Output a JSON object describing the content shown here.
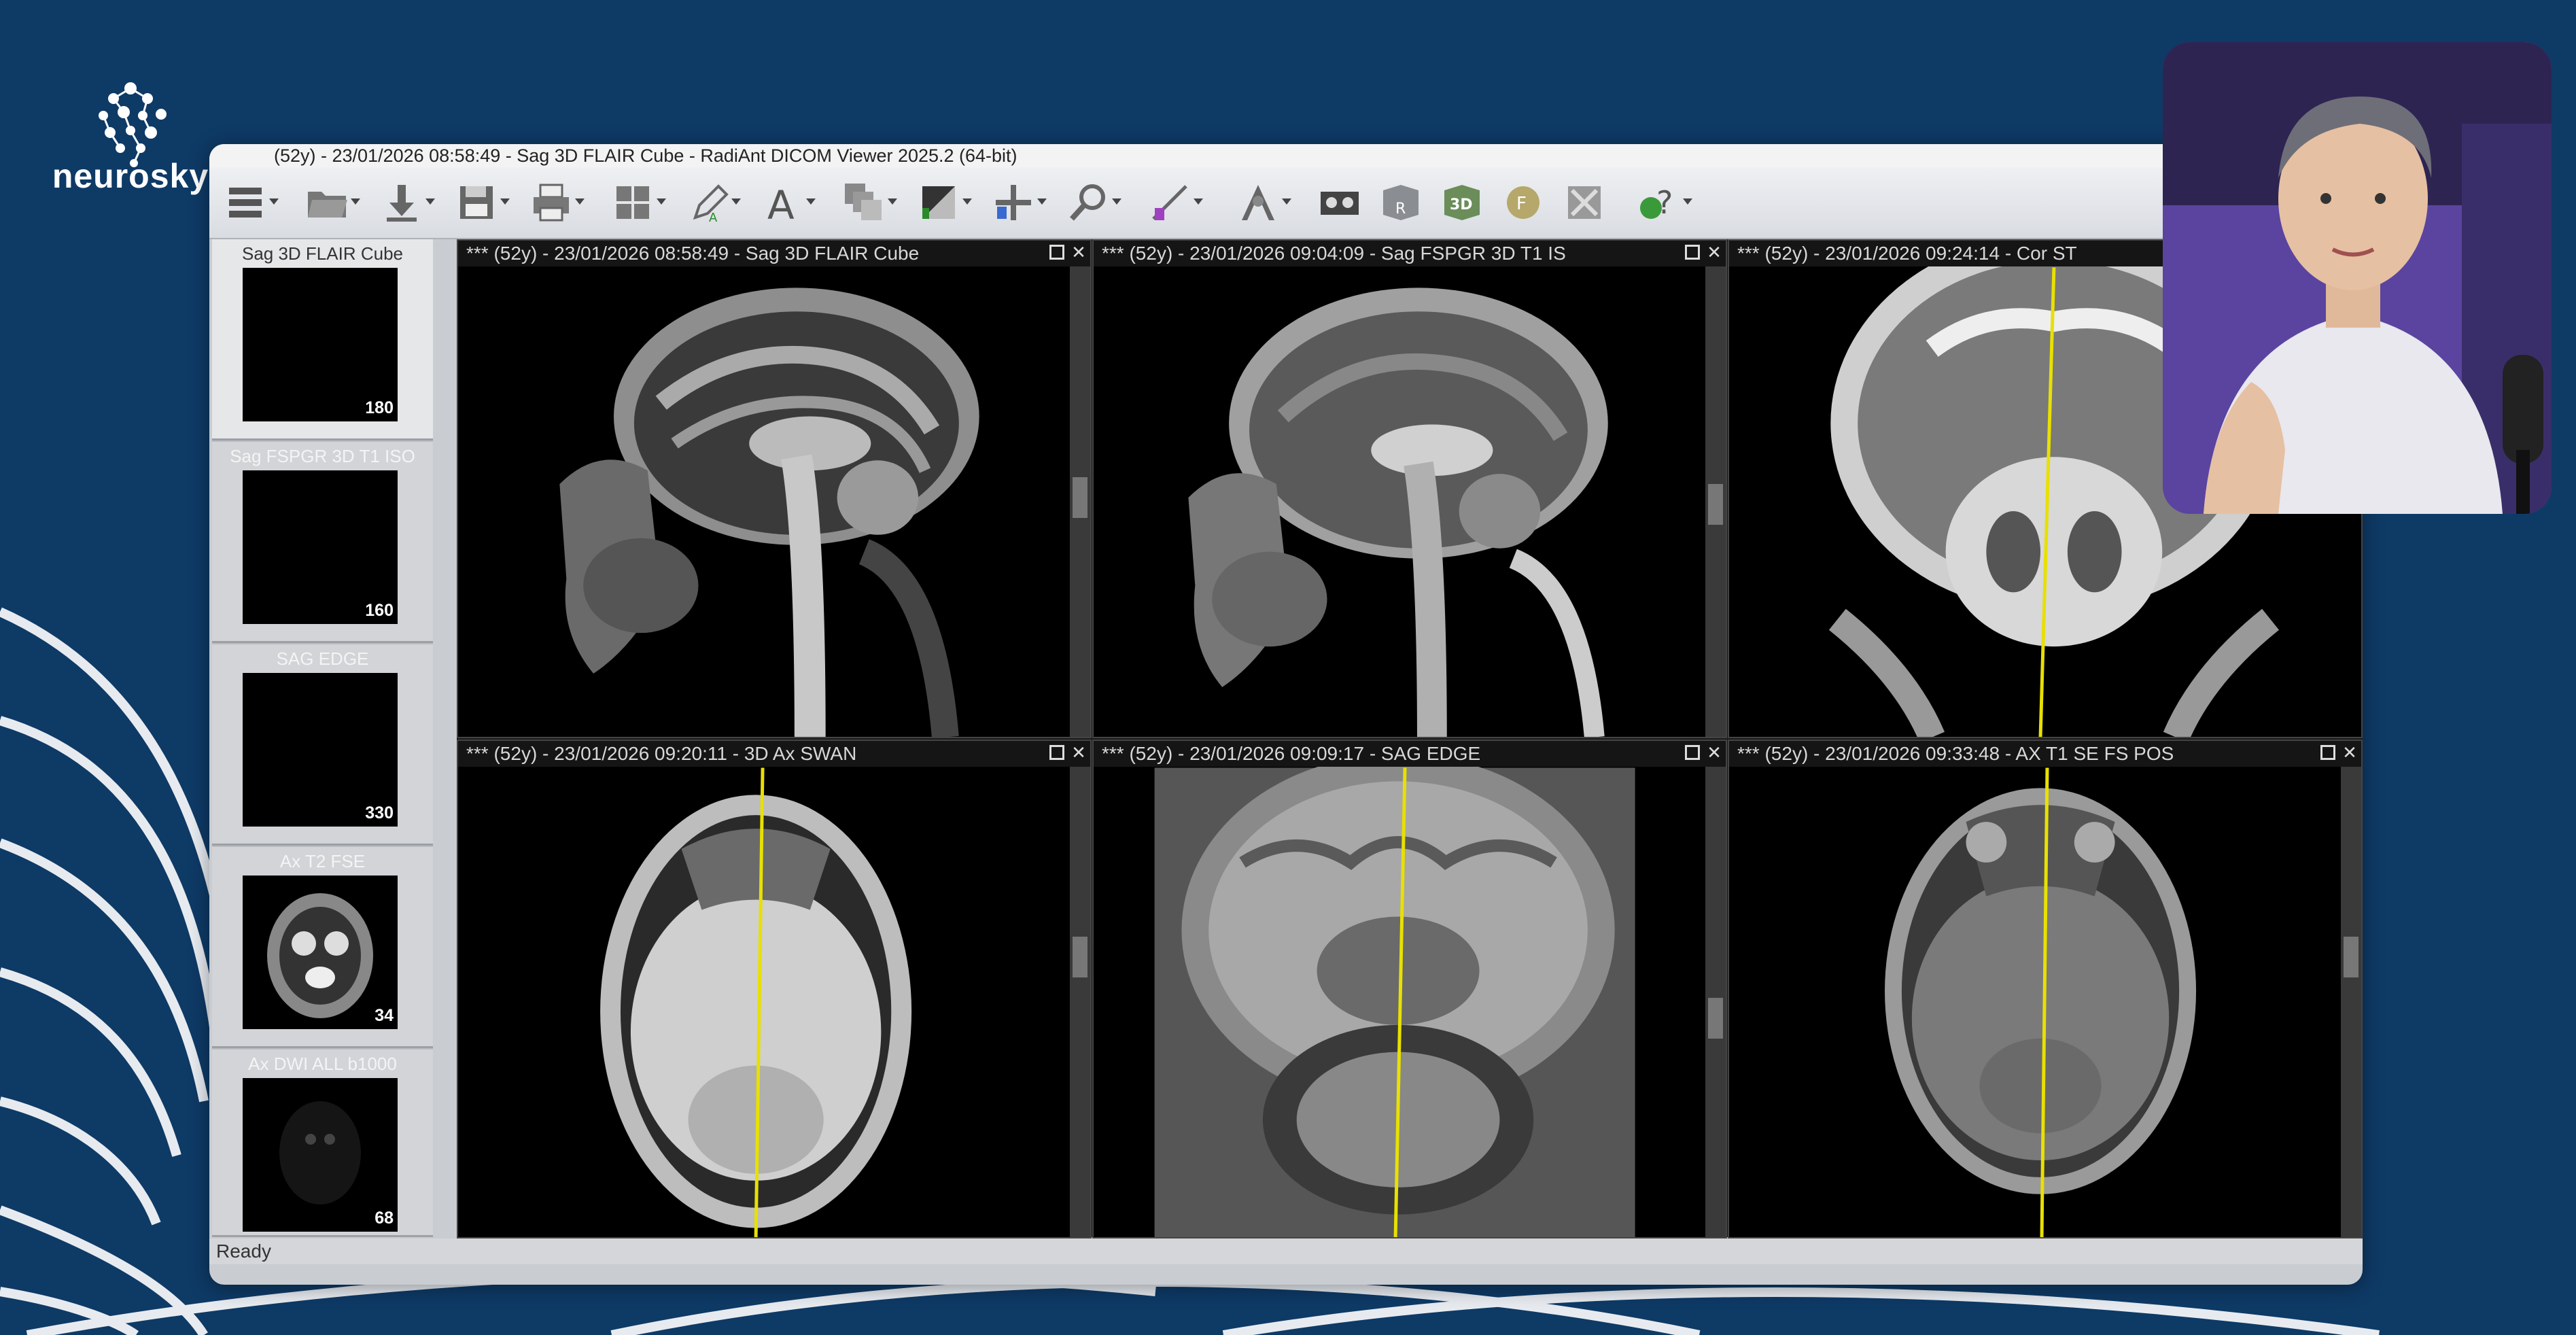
{
  "brand": {
    "name": "neurosky"
  },
  "window": {
    "title": "(52y) - 23/01/2026 08:58:49 - Sag 3D FLAIR Cube - RadiAnt DICOM Viewer 2025.2 (64-bit)"
  },
  "toolbar": {
    "items": [
      {
        "icon": "menu-icon"
      },
      {
        "icon": "open-folder-icon"
      },
      {
        "icon": "download-icon"
      },
      {
        "icon": "save-icon"
      },
      {
        "icon": "print-icon"
      },
      {
        "icon": "layout-grid-icon"
      },
      {
        "icon": "annotate-pen-icon"
      },
      {
        "icon": "text-icon"
      },
      {
        "icon": "series-stack-icon"
      },
      {
        "icon": "window-level-icon"
      },
      {
        "icon": "pan-icon"
      },
      {
        "icon": "zoom-icon"
      },
      {
        "icon": "measure-icon"
      },
      {
        "icon": "scout-lines-icon"
      },
      {
        "icon": "cine-icon"
      },
      {
        "icon": "mpr-icon"
      },
      {
        "icon": "3d-icon"
      },
      {
        "icon": "fusion-icon"
      },
      {
        "icon": "reset-icon"
      },
      {
        "icon": "help-icon"
      }
    ]
  },
  "series_panel": {
    "items": [
      {
        "label": "Sag 3D FLAIR Cube",
        "count": "180",
        "selected": true
      },
      {
        "label": "Sag FSPGR 3D T1 ISO",
        "count": "160",
        "selected": false
      },
      {
        "label": "SAG EDGE",
        "count": "330",
        "selected": false
      },
      {
        "label": "Ax T2 FSE",
        "count": "34",
        "selected": false
      },
      {
        "label": "Ax DWI ALL b1000",
        "count": "68",
        "selected": false
      }
    ]
  },
  "viewports": [
    {
      "header": "*** (52y) - 23/01/2026 08:58:49 - Sag 3D FLAIR Cube"
    },
    {
      "header": "*** (52y) - 23/01/2026 09:04:09 - Sag FSPGR 3D T1 IS"
    },
    {
      "header": "*** (52y) - 23/01/2026 09:24:14 - Cor ST"
    },
    {
      "header": "*** (52y) - 23/01/2026 09:20:11 - 3D Ax SWAN"
    },
    {
      "header": "*** (52y) - 23/01/2026 09:09:17 - SAG EDGE"
    },
    {
      "header": "*** (52y) - 23/01/2026 09:33:48 - AX T1 SE FS POS"
    }
  ],
  "status": {
    "text": "Ready"
  },
  "colors": {
    "background": "#0e3a66",
    "reference_line": "#e8e000"
  }
}
